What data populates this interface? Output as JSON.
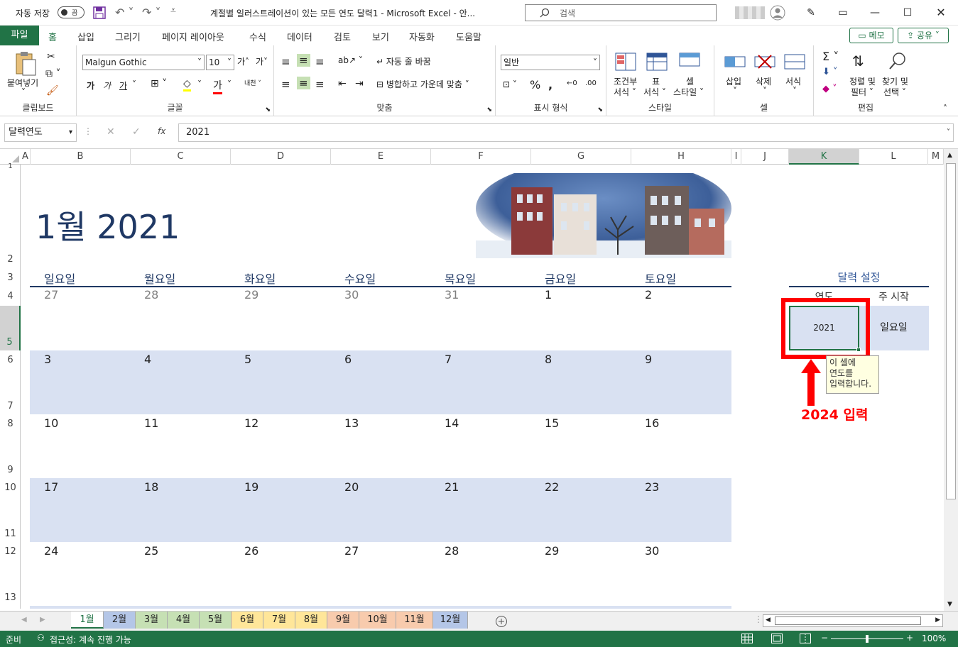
{
  "titlebar": {
    "autosave_label": "자동 저장",
    "autosave_state": "끔",
    "doc_title": "계절별 일러스트레이션이 있는 모든 연도 달력1  -  Microsoft Excel  -  안...",
    "search_placeholder": "검색"
  },
  "ribbon_tabs": [
    "파일",
    "홈",
    "삽입",
    "그리기",
    "페이지 레이아웃",
    "수식",
    "데이터",
    "검토",
    "보기",
    "자동화",
    "도움말"
  ],
  "memo_label": "메모",
  "share_label": "공유",
  "ribbon": {
    "clipboard": {
      "paste": "붙여넣기",
      "group": "클립보드"
    },
    "font": {
      "name": "Malgun Gothic",
      "size": "10",
      "bold": "가",
      "italic": "가",
      "underline": "가",
      "group": "글꼴"
    },
    "align": {
      "wrap": "자동 줄 바꿈",
      "merge": "병합하고 가운데 맞춤",
      "group": "맞춤"
    },
    "number": {
      "format": "일반",
      "group": "표시 형식"
    },
    "style": {
      "cond": "조건부",
      "cond2": "서식",
      "table": "표",
      "table2": "서식",
      "cell": "셀",
      "cell2": "스타일",
      "group": "스타일"
    },
    "cells": {
      "insert": "삽입",
      "delete": "삭제",
      "format": "서식",
      "group": "셀"
    },
    "edit": {
      "sort": "정렬 및",
      "sort2": "필터",
      "find": "찾기 및",
      "find2": "선택",
      "group": "편집"
    }
  },
  "formula_bar": {
    "name_box": "달력연도",
    "fx": "fx",
    "value": "2021"
  },
  "columns": [
    "A",
    "B",
    "C",
    "D",
    "E",
    "F",
    "G",
    "H",
    "I",
    "J",
    "K",
    "L",
    "M"
  ],
  "rows": [
    "1",
    "2",
    "3",
    "4",
    "5",
    "6",
    "7",
    "8",
    "9",
    "10",
    "11",
    "12",
    "13"
  ],
  "calendar": {
    "title": "1월 2021",
    "weekdays": [
      "일요일",
      "월요일",
      "화요일",
      "수요일",
      "목요일",
      "금요일",
      "토요일"
    ],
    "weeks": [
      [
        {
          "d": "27",
          "prev": true
        },
        {
          "d": "28",
          "prev": true
        },
        {
          "d": "29",
          "prev": true
        },
        {
          "d": "30",
          "prev": true
        },
        {
          "d": "31",
          "prev": true
        },
        {
          "d": "1"
        },
        {
          "d": "2"
        }
      ],
      [
        {
          "d": "3"
        },
        {
          "d": "4"
        },
        {
          "d": "5"
        },
        {
          "d": "6"
        },
        {
          "d": "7"
        },
        {
          "d": "8"
        },
        {
          "d": "9"
        }
      ],
      [
        {
          "d": "10"
        },
        {
          "d": "11"
        },
        {
          "d": "12"
        },
        {
          "d": "13"
        },
        {
          "d": "14"
        },
        {
          "d": "15"
        },
        {
          "d": "16"
        }
      ],
      [
        {
          "d": "17"
        },
        {
          "d": "18"
        },
        {
          "d": "19"
        },
        {
          "d": "20"
        },
        {
          "d": "21"
        },
        {
          "d": "22"
        },
        {
          "d": "23"
        }
      ],
      [
        {
          "d": "24"
        },
        {
          "d": "25"
        },
        {
          "d": "26"
        },
        {
          "d": "27"
        },
        {
          "d": "28"
        },
        {
          "d": "29"
        },
        {
          "d": "30"
        }
      ]
    ]
  },
  "settings": {
    "title": "달력 설정",
    "year_header": "연도",
    "week_header": "주 시작",
    "year_value": "2021",
    "week_value": "일요일",
    "tooltip": "이 셀에\n연도를\n입력합니다.",
    "annotation": "2024 입력",
    "annotation_color": "#ff0000"
  },
  "sheet_tabs": [
    {
      "name": "1월",
      "color": "#ffffff",
      "active": true
    },
    {
      "name": "2월",
      "color": "#b4c6e7"
    },
    {
      "name": "3월",
      "color": "#c6e0b4"
    },
    {
      "name": "4월",
      "color": "#c6e0b4"
    },
    {
      "name": "5월",
      "color": "#c6e0b4"
    },
    {
      "name": "6월",
      "color": "#ffe699"
    },
    {
      "name": "7월",
      "color": "#ffe699"
    },
    {
      "name": "8월",
      "color": "#ffe699"
    },
    {
      "name": "9월",
      "color": "#f8cbad"
    },
    {
      "name": "10월",
      "color": "#f8cbad"
    },
    {
      "name": "11월",
      "color": "#f8cbad"
    },
    {
      "name": "12월",
      "color": "#b4c6e7"
    }
  ],
  "status": {
    "ready": "준비",
    "accessibility": "접근성: 계속 진행 가능",
    "zoom": "100%"
  },
  "colors": {
    "accent": "#217346",
    "band": "#d9e1f2",
    "title": "#1f3864"
  }
}
